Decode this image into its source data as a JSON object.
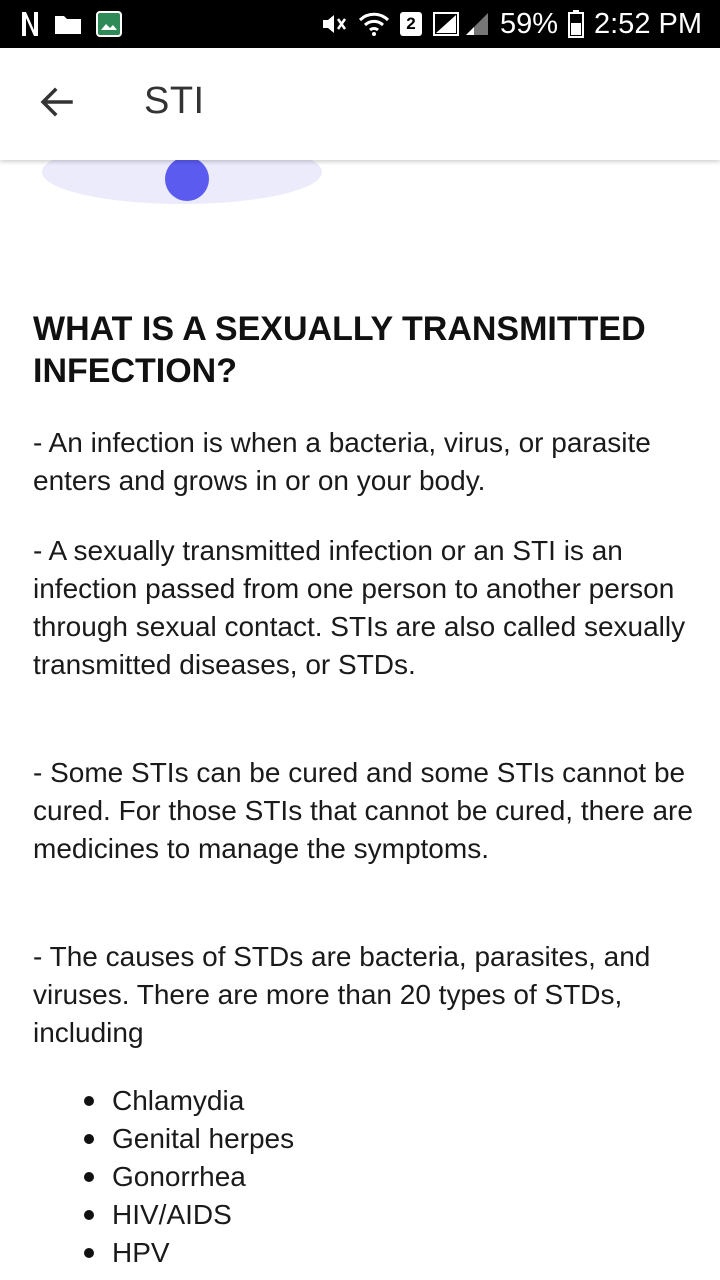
{
  "status_bar": {
    "battery": "59%",
    "time": "2:52 PM",
    "sim_number": "2",
    "icons": [
      "netflix-icon",
      "folder-icon",
      "gallery-icon",
      "mute-icon",
      "wifi-icon",
      "sim-icon",
      "signal-icon",
      "battery-icon"
    ]
  },
  "app_bar": {
    "title": "STI",
    "back_icon": "arrow-left-icon"
  },
  "article": {
    "heading": "WHAT IS A SEXUALLY TRANSMITTED INFECTION?",
    "paragraphs": [
      "- An infection is when a bacteria, virus, or parasite enters and grows in or on your body.",
      "- A sexually transmitted infection or an STI is an infection passed from one person to another person through sexual contact. STIs are also called sexually transmitted diseases, or STDs.",
      "- Some STIs can be cured and some STIs cannot be cured. For those STIs that cannot be cured, there are medicines to manage the symptoms.",
      "- The causes of STDs are bacteria, parasites, and viruses. There are more than 20 types of STDs, including"
    ],
    "list_items": [
      "Chlamydia",
      "Genital herpes",
      "Gonorrhea",
      "HIV/AIDS",
      "HPV"
    ]
  },
  "colors": {
    "illustration_bg": "#ECEBFB",
    "illustration_dot": "#5B5BF0"
  }
}
